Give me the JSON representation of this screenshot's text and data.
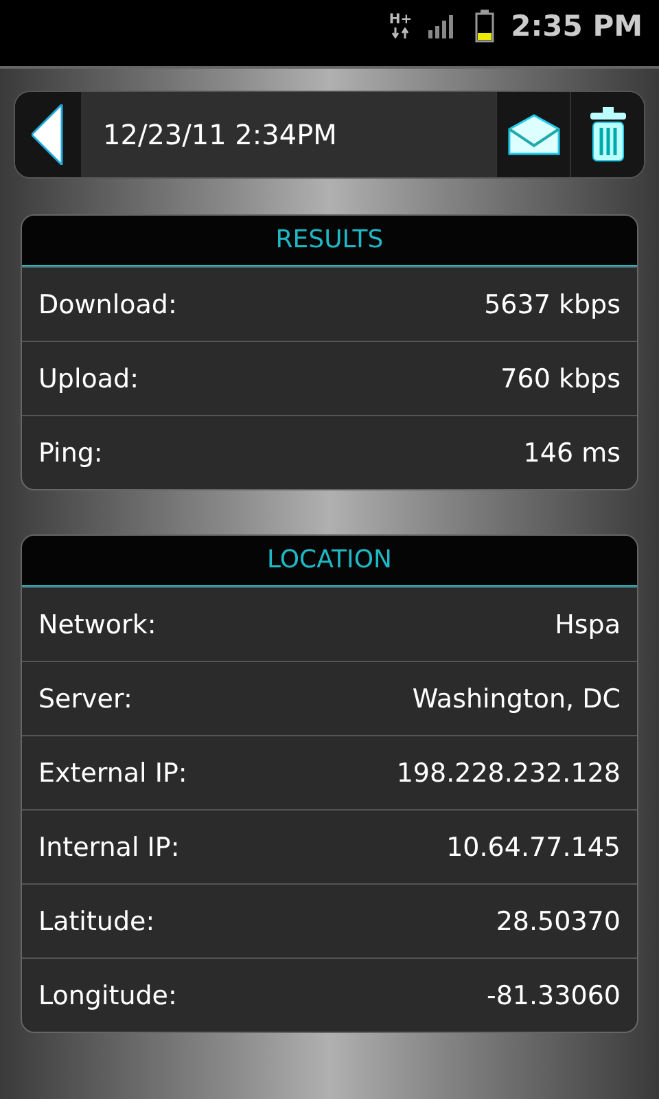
{
  "status_bar": {
    "network_type": "H+",
    "time": "2:35 PM"
  },
  "header": {
    "title": "12/23/11 2:34PM"
  },
  "sections": [
    {
      "title": "RESULTS",
      "rows": [
        {
          "label": "Download:",
          "value": "5637 kbps"
        },
        {
          "label": "Upload:",
          "value": "760 kbps"
        },
        {
          "label": "Ping:",
          "value": "146 ms"
        }
      ]
    },
    {
      "title": "LOCATION",
      "rows": [
        {
          "label": "Network:",
          "value": "Hspa"
        },
        {
          "label": "Server:",
          "value": "Washington, DC"
        },
        {
          "label": "External IP:",
          "value": "198.228.232.128"
        },
        {
          "label": "Internal IP:",
          "value": "10.64.77.145"
        },
        {
          "label": "Latitude:",
          "value": "28.50370"
        },
        {
          "label": "Longitude:",
          "value": "-81.33060"
        }
      ]
    }
  ]
}
